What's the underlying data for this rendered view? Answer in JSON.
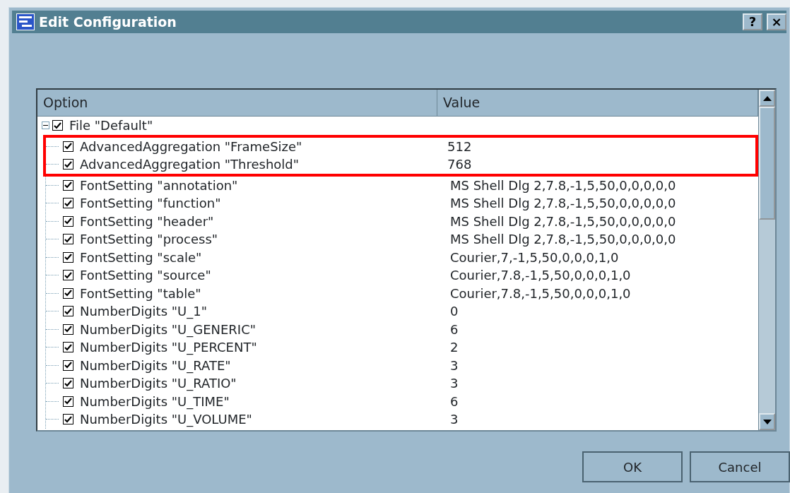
{
  "window": {
    "title": "Edit Configuration",
    "title_buttons": [
      "?",
      "×"
    ]
  },
  "table": {
    "columns": [
      "Option",
      "Value"
    ],
    "root": {
      "label": "File \"Default\"",
      "checked": true,
      "expanded": true,
      "children": [
        {
          "label": "AdvancedAggregation \"FrameSize\"",
          "value": "512",
          "checked": true,
          "highlighted": true
        },
        {
          "label": "AdvancedAggregation \"Threshold\"",
          "value": "768",
          "checked": true,
          "highlighted": true
        },
        {
          "label": "FontSetting \"annotation\"",
          "value": "MS Shell Dlg 2,7.8,-1,5,50,0,0,0,0,0",
          "checked": true,
          "highlighted": false
        },
        {
          "label": "FontSetting \"function\"",
          "value": "MS Shell Dlg 2,7.8,-1,5,50,0,0,0,0,0",
          "checked": true,
          "highlighted": false
        },
        {
          "label": "FontSetting \"header\"",
          "value": "MS Shell Dlg 2,7.8,-1,5,50,0,0,0,0,0",
          "checked": true,
          "highlighted": false
        },
        {
          "label": "FontSetting \"process\"",
          "value": "MS Shell Dlg 2,7.8,-1,5,50,0,0,0,0,0",
          "checked": true,
          "highlighted": false
        },
        {
          "label": "FontSetting \"scale\"",
          "value": "Courier,7,-1,5,50,0,0,0,1,0",
          "checked": true,
          "highlighted": false
        },
        {
          "label": "FontSetting \"source\"",
          "value": "Courier,7.8,-1,5,50,0,0,0,1,0",
          "checked": true,
          "highlighted": false
        },
        {
          "label": "FontSetting \"table\"",
          "value": "Courier,7.8,-1,5,50,0,0,0,1,0",
          "checked": true,
          "highlighted": false
        },
        {
          "label": "NumberDigits \"U_1\"",
          "value": "0",
          "checked": true,
          "highlighted": false
        },
        {
          "label": "NumberDigits \"U_GENERIC\"",
          "value": "6",
          "checked": true,
          "highlighted": false
        },
        {
          "label": "NumberDigits \"U_PERCENT\"",
          "value": "2",
          "checked": true,
          "highlighted": false
        },
        {
          "label": "NumberDigits \"U_RATE\"",
          "value": "3",
          "checked": true,
          "highlighted": false
        },
        {
          "label": "NumberDigits \"U_RATIO\"",
          "value": "3",
          "checked": true,
          "highlighted": false
        },
        {
          "label": "NumberDigits \"U_TIME\"",
          "value": "6",
          "checked": true,
          "highlighted": false
        },
        {
          "label": "NumberDigits \"U_VOLUME\"",
          "value": "3",
          "checked": true,
          "highlighted": false
        }
      ]
    }
  },
  "buttons": [
    "OK",
    "Cancel"
  ]
}
